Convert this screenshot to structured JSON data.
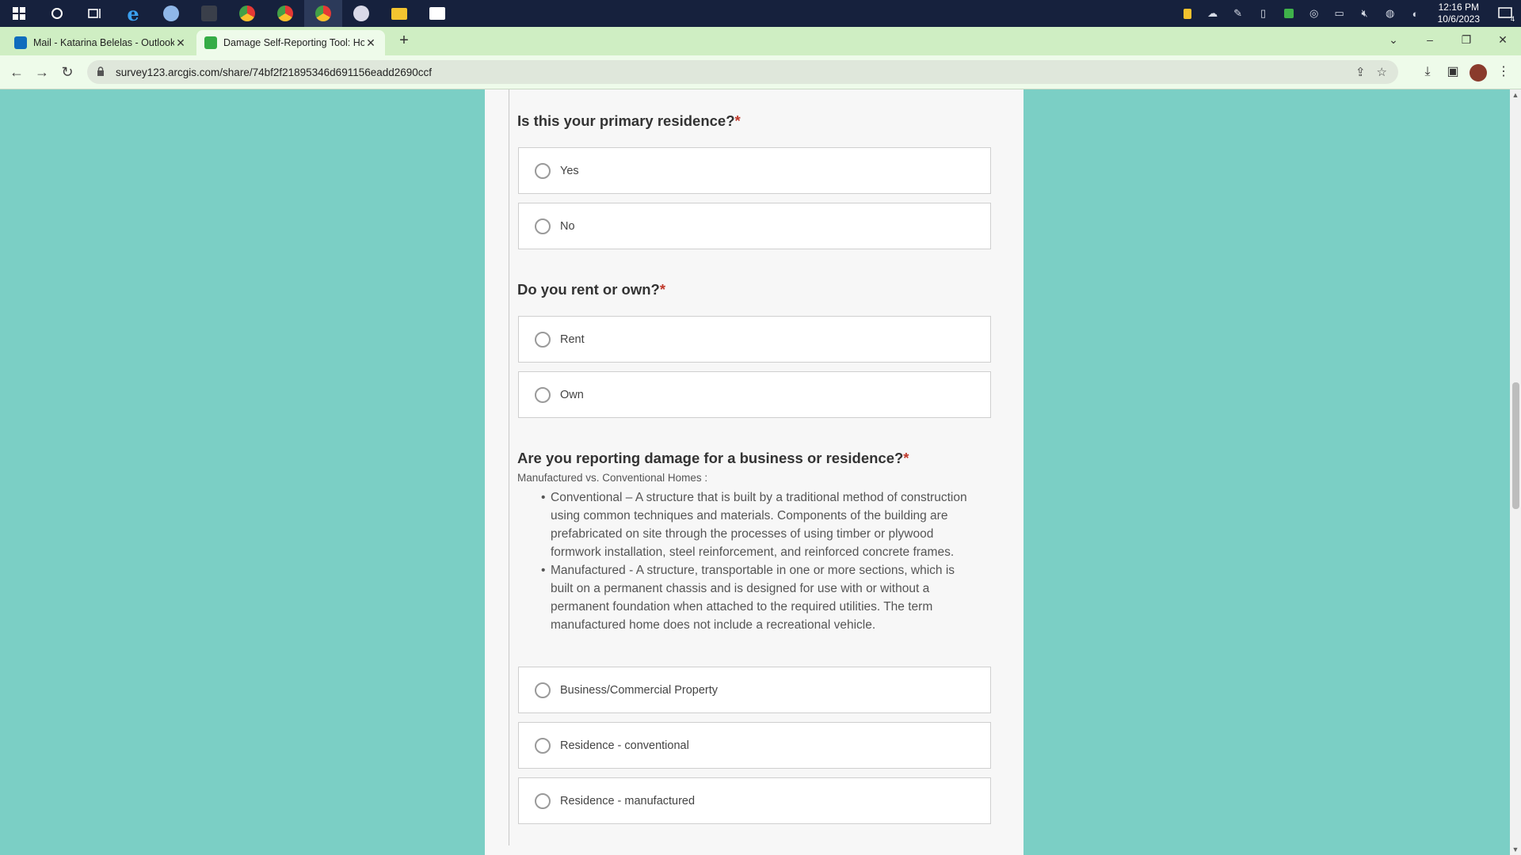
{
  "taskbar": {
    "clock_time": "12:16 PM",
    "clock_date": "10/6/2023",
    "notification_count": "4"
  },
  "tabs": [
    {
      "title": "Mail - Katarina Belelas - Outlook",
      "close": "✕"
    },
    {
      "title": "Damage Self-Reporting Tool: Ho",
      "close": "✕"
    }
  ],
  "new_tab": "+",
  "window_controls": {
    "dropdown": "⌄",
    "minimize": "–",
    "restore": "❐",
    "close": "✕"
  },
  "address_bar": {
    "url": "survey123.arcgis.com/share/74bf2f21895346d691156eadd2690ccf"
  },
  "form": {
    "q1": {
      "label": "Is this your primary residence?",
      "required_mark": "*",
      "options": [
        "Yes",
        "No"
      ]
    },
    "q2": {
      "label": "Do you rent or own?",
      "required_mark": "*",
      "options": [
        "Rent",
        "Own"
      ]
    },
    "q3": {
      "label": "Are you reporting damage for a business or residence?",
      "required_mark": "*",
      "hint_title": "Manufactured vs. Conventional Homes :",
      "bullets": [
        "Conventional – A structure that is built by a traditional method of construction using common techniques and materials. Components of the building are prefabricated on site through the processes of using timber or plywood formwork installation, steel reinforcement, and reinforced concrete frames.",
        "Manufactured - A structure, transportable in one or more sections, which is built on a permanent chassis and is designed for use with or without a permanent foundation when attached to the required utilities. The term manufactured home does not include a recreational vehicle."
      ],
      "options": [
        "Business/Commercial Property",
        "Residence - conventional",
        "Residence - manufactured"
      ]
    }
  },
  "colors": {
    "page_background": "#7bcfc5",
    "card_background": "#f7f7f7",
    "required": "#c0392b",
    "taskbar": "#16213d",
    "tabstrip": "#cfeec3"
  }
}
